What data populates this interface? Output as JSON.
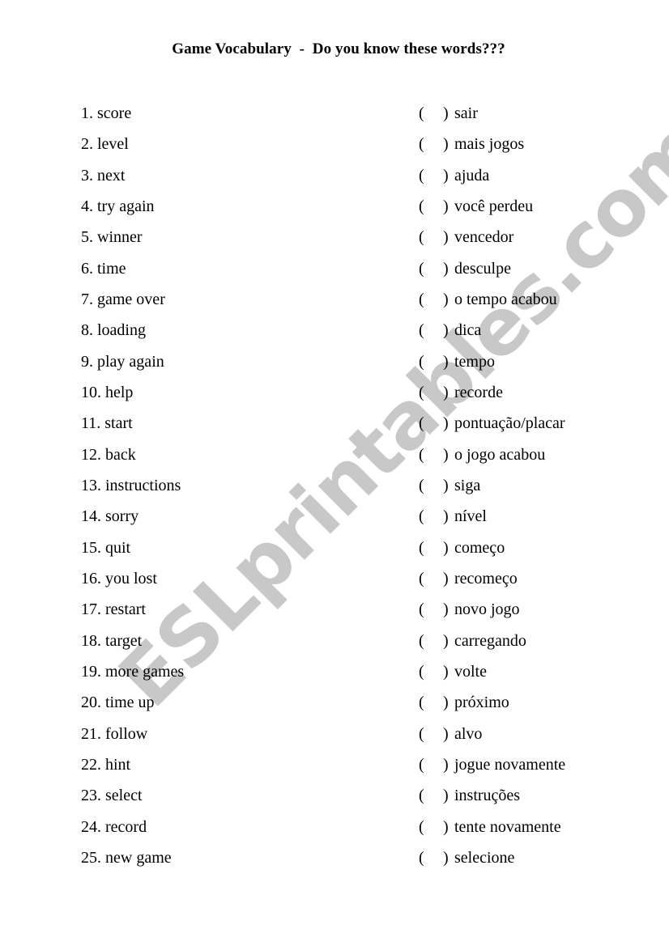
{
  "title": "Game Vocabulary  -  Do you know these words???",
  "watermark": {
    "text": "ESLprintables.com",
    "color": "#c8c8c8"
  },
  "english_words": [
    "1. score",
    "2. level",
    "3. next",
    "4. try again",
    "5. winner",
    "6. time",
    "7. game over",
    "8. loading",
    "9. play again",
    "10. help",
    "11. start",
    "12. back",
    "13. instructions",
    "14. sorry",
    "15. quit",
    "16. you lost",
    "17. restart",
    "18. target",
    "19. more games",
    "20. time up",
    "21. follow",
    "22. hint",
    "23. select",
    "24. record",
    "25. new game"
  ],
  "answer_blank": {
    "open": "(",
    "close": ")"
  },
  "portuguese_words": [
    "sair",
    "mais jogos",
    "ajuda",
    "você perdeu",
    "vencedor",
    "desculpe",
    "o tempo acabou",
    "dica",
    "tempo",
    "recorde",
    "pontuação/placar",
    "o jogo acabou",
    "siga",
    "nível",
    "começo",
    "recomeço",
    "novo jogo",
    "carregando",
    "volte",
    "próximo",
    "alvo",
    "jogue novamente",
    "instruções",
    "tente novamente",
    "selecione"
  ]
}
